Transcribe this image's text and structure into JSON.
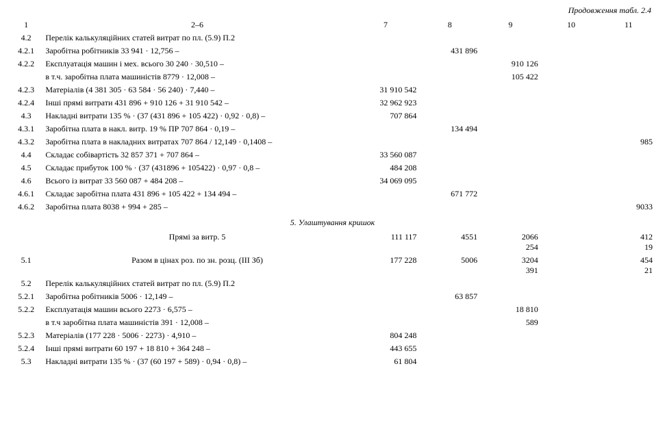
{
  "continuation": "Продовження табл. 2.4",
  "headers": {
    "c1": "1",
    "c2": "2–6",
    "c7": "7",
    "c8": "8",
    "c9": "9",
    "c10": "10",
    "c11": "11"
  },
  "rows": [
    {
      "n": "4.2",
      "t": "Перелік калькуляційних статей витрат по пл. (5.9) П.2",
      "v7": "",
      "v8": "",
      "v9": "",
      "v10": "",
      "v11": ""
    },
    {
      "n": "4.2.1",
      "t": "Заробітна робітників 33 941 · 12,756 –",
      "v7": "",
      "v8": "431 896",
      "v9": "",
      "v10": "",
      "v11": ""
    },
    {
      "n": "4.2.2",
      "t": "Експлуатація машин і мех. всього 30 240 · 30,510 –",
      "v7": "",
      "v8": "",
      "v9": "910 126",
      "v10": "",
      "v11": ""
    },
    {
      "n": "",
      "t": "в т.ч. заробітна плата машиністів 8779 · 12,008 –",
      "v7": "",
      "v8": "",
      "v9": "105 422",
      "v10": "",
      "v11": ""
    },
    {
      "n": "4.2.3",
      "t": "Матеріалів (4 381 305 · 63 584 · 56 240) · 7,440 –",
      "v7": "31 910 542",
      "v8": "",
      "v9": "",
      "v10": "",
      "v11": ""
    },
    {
      "n": "4.2.4",
      "t": "Інші прямі витрати 431 896 + 910 126 + 31 910 542 –",
      "v7": "32 962 923",
      "v8": "",
      "v9": "",
      "v10": "",
      "v11": ""
    },
    {
      "n": "4.3",
      "t": "Накладні витрати 135 % · (37 (431 896 + 105 422) · 0,92 · 0,8) –",
      "v7": "707 864",
      "v8": "",
      "v9": "",
      "v10": "",
      "v11": ""
    },
    {
      "n": "4.3.1",
      "t": "Заробітна плата в накл. витр. 19 % ПР 707 864 · 0,19 –",
      "v7": "",
      "v8": "134 494",
      "v9": "",
      "v10": "",
      "v11": ""
    },
    {
      "n": "4.3.2",
      "t": "Заробітна плата в накладних витратах 707 864 / 12,149 · 0,1408 –",
      "v7": "",
      "v8": "",
      "v9": "",
      "v10": "",
      "v11": "985"
    },
    {
      "n": "4.4",
      "t": "Складає собівартість 32 857 371 + 707 864 –",
      "v7": "33 560 087",
      "v8": "",
      "v9": "",
      "v10": "",
      "v11": ""
    },
    {
      "n": "4.5",
      "t": "Складає прибуток 100 % · (37 (431896 + 105422) · 0,97 · 0,8 –",
      "v7": "484 208",
      "v8": "",
      "v9": "",
      "v10": "",
      "v11": ""
    },
    {
      "n": "4.6",
      "t": "Всього із витрат 33 560 087 + 484 208 –",
      "v7": "34 069 095",
      "v8": "",
      "v9": "",
      "v10": "",
      "v11": ""
    },
    {
      "n": "4.6.1",
      "t": "Складає заробітна плата 431 896 + 105 422 + 134 494 –",
      "v7": "",
      "v8": "671 772",
      "v9": "",
      "v10": "",
      "v11": ""
    },
    {
      "n": "4.6.2",
      "t": "Заробітна плата 8038 + 994 + 285 –",
      "v7": "",
      "v8": "",
      "v9": "",
      "v10": "",
      "v11": "9033"
    }
  ],
  "section2": "5. Улаштування кришок",
  "rows2a": [
    {
      "n": "",
      "t": "Прямі за витр. 5",
      "v7": "111 117",
      "v8": "4551",
      "v9a": "2066",
      "v9b": "254",
      "v10": "",
      "v11a": "412",
      "v11b": "19"
    },
    {
      "n": "5.1",
      "t": "Разом в цінах роз. по зн. розц. (ІІІ Зб)",
      "v7": "177 228",
      "v8": "5006",
      "v9a": "3204",
      "v9b": "391",
      "v10": "",
      "v11a": "454",
      "v11b": "21"
    }
  ],
  "rows2b": [
    {
      "n": "5.2",
      "t": "Перелік калькуляційних статей витрат по пл. (5.9) П.2",
      "v7": "",
      "v8": "",
      "v9": "",
      "v10": "",
      "v11": ""
    },
    {
      "n": "5.2.1",
      "t": "Заробітна робітників 5006 · 12,149 –",
      "v7": "",
      "v8": "63 857",
      "v9": "",
      "v10": "",
      "v11": ""
    },
    {
      "n": "5.2.2",
      "t": "Експлуатація машин всього 2273 · 6,575 –",
      "v7": "",
      "v8": "",
      "v9": "18 810",
      "v10": "",
      "v11": ""
    },
    {
      "n": "",
      "t": "в т.ч заробітна плата машиністів 391 · 12,008 –",
      "v7": "",
      "v8": "",
      "v9": "589",
      "v10": "",
      "v11": ""
    },
    {
      "n": "5.2.3",
      "t": "Матеріалів (177 228 · 5006 · 2273) · 4,910 –",
      "v7": "804 248",
      "v8": "",
      "v9": "",
      "v10": "",
      "v11": ""
    },
    {
      "n": "5.2.4",
      "t": "Інші прямі витрати 60 197 + 18 810 + 364 248 –",
      "v7": "443 655",
      "v8": "",
      "v9": "",
      "v10": "",
      "v11": ""
    },
    {
      "n": "5.3",
      "t": "Накладні витрати 135 % · (37 (60 197 + 589) · 0,94 · 0,8) –",
      "v7": "61 804",
      "v8": "",
      "v9": "",
      "v10": "",
      "v11": ""
    }
  ]
}
